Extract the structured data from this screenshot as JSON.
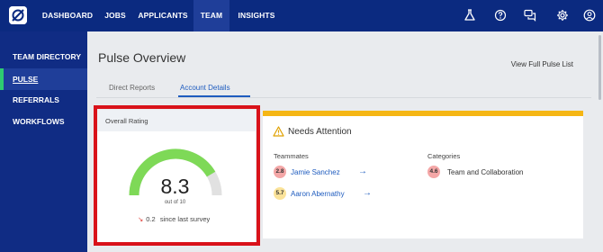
{
  "topnav": {
    "items": [
      {
        "label": "DASHBOARD",
        "active": false
      },
      {
        "label": "JOBS",
        "active": false
      },
      {
        "label": "APPLICANTS",
        "active": false
      },
      {
        "label": "TEAM",
        "active": true
      },
      {
        "label": "INSIGHTS",
        "active": false
      }
    ],
    "icons": [
      "flask-icon",
      "help-icon",
      "chat-icon",
      "gear-icon",
      "user-icon"
    ]
  },
  "sidebar": {
    "items": [
      {
        "label": "TEAM DIRECTORY",
        "active": false
      },
      {
        "label": "PULSE",
        "active": true
      },
      {
        "label": "REFERRALS",
        "active": false
      },
      {
        "label": "WORKFLOWS",
        "active": false
      }
    ]
  },
  "main": {
    "title": "Pulse Overview",
    "full_list_link": "View Full Pulse List",
    "tabs": [
      {
        "label": "Direct Reports",
        "active": false
      },
      {
        "label": "Account Details",
        "active": true
      }
    ]
  },
  "rating": {
    "header": "Overall Rating",
    "value": "8.3",
    "scale": "out of 10",
    "gauge_fraction": 0.83,
    "change": "0.2",
    "change_text": "since last survey",
    "colors": {
      "fill": "#7ed957",
      "track": "#e1e1e1",
      "down": "#e0413a"
    }
  },
  "attention": {
    "title": "Needs Attention",
    "accent": "#f5b614",
    "teammates_header": "Teammates",
    "categories_header": "Categories",
    "teammates": [
      {
        "score": "2.8",
        "name": "Jamie Sanchez",
        "level": "low"
      },
      {
        "score": "5.7",
        "name": "Aaron Abernathy",
        "level": "mid"
      }
    ],
    "categories": [
      {
        "score": "4.6",
        "name": "Team and Collaboration",
        "level": "low"
      }
    ]
  }
}
